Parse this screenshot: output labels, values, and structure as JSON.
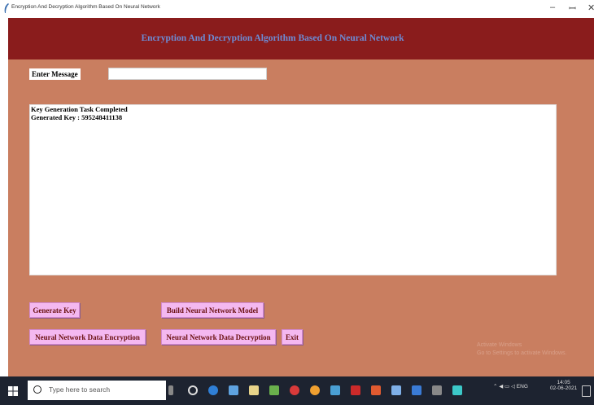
{
  "window": {
    "title": "Encryption And Decryption Algorithm Based On Neural Network",
    "minimize": "–",
    "maximize": "ꟷ",
    "close": "✕"
  },
  "header": {
    "title": "Encryption And Decryption Algorithm Based On Neural Network"
  },
  "form": {
    "message_label": "Enter Message",
    "message_value": ""
  },
  "output": {
    "lines": [
      "Key Generation Task Completed",
      "Generated Key : 595248411138"
    ]
  },
  "buttons": {
    "generate_key": "Generate Key",
    "build_model": "Build Neural Network Model",
    "encrypt": "Neural Network Data Encryption",
    "decrypt": "Neural Network Data Decryption",
    "exit": "Exit"
  },
  "watermark": {
    "line1": "Activate Windows",
    "line2": "Go to Settings to activate Windows."
  },
  "taskbar": {
    "search_placeholder": "Type here to search",
    "time": "14:05",
    "date": "02-06-2021"
  },
  "colors": {
    "header_bg": "#8a1c1c",
    "header_text": "#6d8bd4",
    "app_bg": "#c97e60",
    "button_bg": "#f4b8f0",
    "button_text": "#6a1010"
  }
}
